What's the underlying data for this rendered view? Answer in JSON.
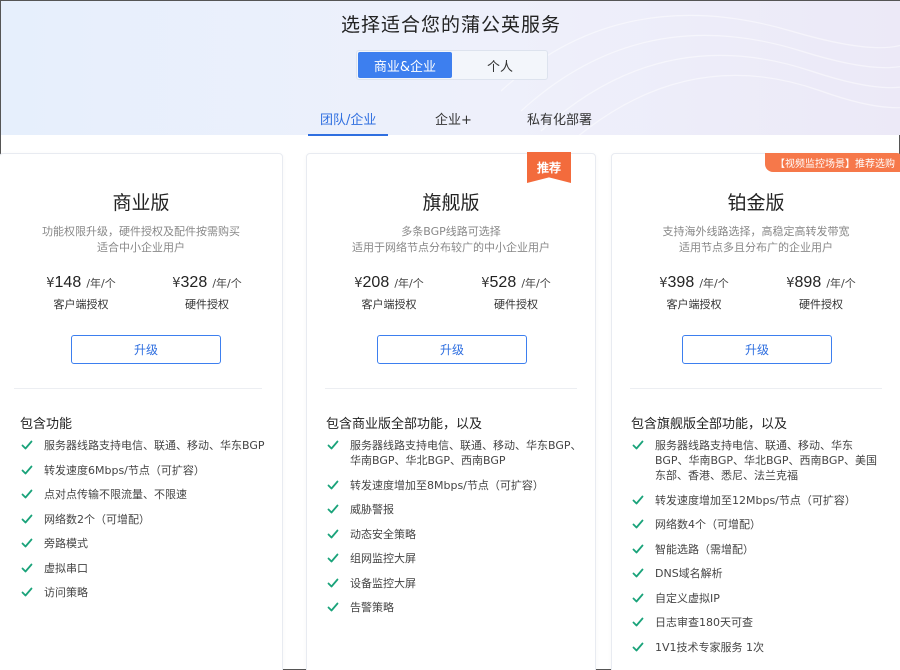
{
  "header": {
    "title": "选择适合您的蒲公英服务",
    "segments": [
      "商业&企业",
      "个人"
    ],
    "tabs": [
      "团队/企业",
      "企业+",
      "私有化部署"
    ]
  },
  "colors": {
    "accent": "#3d7fef",
    "badge": "#f36b3c",
    "check": "#1aa37a"
  },
  "plans": [
    {
      "name": "商业版",
      "desc_lines": [
        "功能权限升级，硬件授权及配件按需购买",
        "适合中小企业用户"
      ],
      "prices": [
        {
          "currency": "¥",
          "amount": "148",
          "unit": "/年/个",
          "label": "客户端授权"
        },
        {
          "currency": "¥",
          "amount": "328",
          "unit": "/年/个",
          "label": "硬件授权"
        }
      ],
      "button": "升级",
      "features_title": "包含功能",
      "features": [
        "服务器线路支持电信、联通、移动、华东BGP",
        "转发速度6Mbps/节点（可扩容）",
        "点对点传输不限流量、不限速",
        "网络数2个（可增配）",
        "旁路模式",
        "虚拟串口",
        "访问策略"
      ]
    },
    {
      "name": "旗舰版",
      "badge": "推荐",
      "desc_lines": [
        "多条BGP线路可选择",
        "适用于网络节点分布较广的中小企业用户"
      ],
      "prices": [
        {
          "currency": "¥",
          "amount": "208",
          "unit": "/年/个",
          "label": "客户端授权"
        },
        {
          "currency": "¥",
          "amount": "528",
          "unit": "/年/个",
          "label": "硬件授权"
        }
      ],
      "button": "升级",
      "features_title": "包含商业版全部功能，以及",
      "features": [
        "服务器线路支持电信、联通、移动、华东BGP、华南BGP、华北BGP、西南BGP",
        "转发速度增加至8Mbps/节点（可扩容）",
        "威胁警报",
        "动态安全策略",
        "组网监控大屏",
        "设备监控大屏",
        "告警策略"
      ]
    },
    {
      "name": "铂金版",
      "badge": "【视频监控场景】推荐选购",
      "desc_lines": [
        "支持海外线路选择，高稳定高转发带宽",
        "适用节点多且分布广的企业用户"
      ],
      "prices": [
        {
          "currency": "¥",
          "amount": "398",
          "unit": "/年/个",
          "label": "客户端授权"
        },
        {
          "currency": "¥",
          "amount": "898",
          "unit": "/年/个",
          "label": "硬件授权"
        }
      ],
      "button": "升级",
      "features_title": "包含旗舰版全部功能，以及",
      "features": [
        "服务器线路支持电信、联通、移动、华东BGP、华南BGP、华北BGP、西南BGP、美国东部、香港、悉尼、法兰克福",
        "转发速度增加至12Mbps/节点（可扩容）",
        "网络数4个（可增配）",
        "智能选路（需增配）",
        "DNS域名解析",
        "自定义虚拟IP",
        "日志审查180天可查",
        "1V1技术专家服务 1次"
      ]
    }
  ]
}
